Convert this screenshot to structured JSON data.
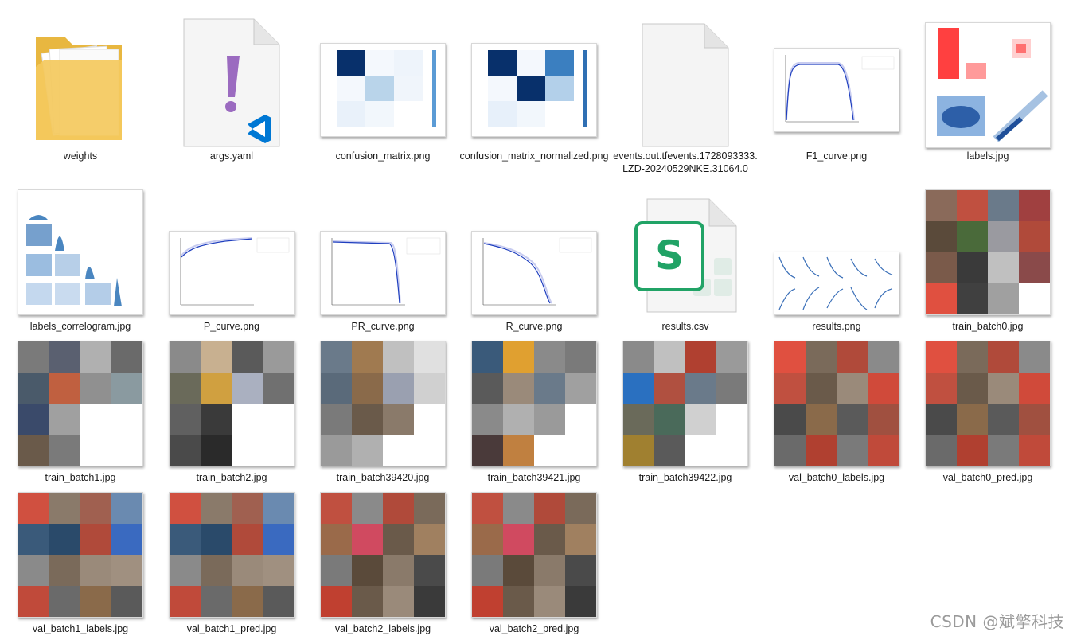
{
  "items": [
    {
      "label": "weights",
      "kind": "folder"
    },
    {
      "label": "args.yaml",
      "kind": "yaml"
    },
    {
      "label": "confusion_matrix.png",
      "kind": "confusion"
    },
    {
      "label": "confusion_matrix_normalized.png",
      "kind": "confusion-normalized"
    },
    {
      "label": "events.out.tfevents.1728093333.LZD-20240529NKE.31064.0",
      "kind": "blank-file"
    },
    {
      "label": "F1_curve.png",
      "kind": "curve"
    },
    {
      "label": "labels.jpg",
      "kind": "labels"
    },
    {
      "label": "labels_correlogram.jpg",
      "kind": "correlogram"
    },
    {
      "label": "P_curve.png",
      "kind": "curve"
    },
    {
      "label": "PR_curve.png",
      "kind": "curve"
    },
    {
      "label": "R_curve.png",
      "kind": "curve"
    },
    {
      "label": "results.csv",
      "kind": "csv"
    },
    {
      "label": "results.png",
      "kind": "results"
    },
    {
      "label": "train_batch0.jpg",
      "kind": "collage"
    },
    {
      "label": "train_batch1.jpg",
      "kind": "collage"
    },
    {
      "label": "train_batch2.jpg",
      "kind": "collage"
    },
    {
      "label": "train_batch39420.jpg",
      "kind": "collage"
    },
    {
      "label": "train_batch39421.jpg",
      "kind": "collage"
    },
    {
      "label": "train_batch39422.jpg",
      "kind": "collage"
    },
    {
      "label": "val_batch0_labels.jpg",
      "kind": "collage"
    },
    {
      "label": "val_batch0_pred.jpg",
      "kind": "collage"
    },
    {
      "label": "val_batch1_labels.jpg",
      "kind": "collage"
    },
    {
      "label": "val_batch1_pred.jpg",
      "kind": "collage"
    },
    {
      "label": "val_batch2_labels.jpg",
      "kind": "collage"
    },
    {
      "label": "val_batch2_pred.jpg",
      "kind": "collage"
    }
  ],
  "watermark": "CSDN @斌擎科技",
  "colors": {
    "folder": "#f4c95d",
    "vscode_blue": "#0078d4",
    "yaml_mark": "#9b6bc0",
    "heatmap_dark": "#08306b",
    "curve_blue": "#1f3fbf",
    "csv_green": "#21a366",
    "bar_red": "#ff4040"
  }
}
